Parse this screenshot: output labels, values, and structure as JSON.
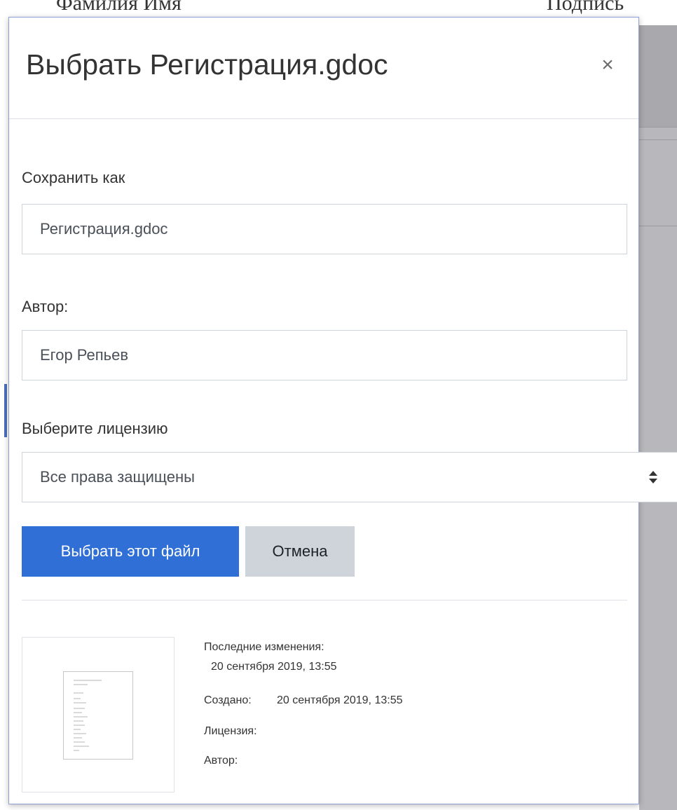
{
  "background": {
    "header_left": "Фамилия Имя",
    "header_right": "Подпись"
  },
  "dialog": {
    "title": "Выбрать Регистрация.gdoc",
    "close_label": "×"
  },
  "form": {
    "save_as_label": "Сохранить как",
    "save_as_value": "Регистрация.gdoc",
    "author_label": "Автор:",
    "author_value": "Егор Репьев",
    "license_label": "Выберите лицензию",
    "license_value": "Все права защищены"
  },
  "actions": {
    "select_label": "Выбрать этот файл",
    "cancel_label": "Отмена"
  },
  "details": {
    "modified_label": "Последние изменения:",
    "modified_value": "20 сентября 2019, 13:55",
    "created_label": "Создано:",
    "created_value": "20 сентября 2019, 13:55",
    "license_label": "Лицензия:",
    "author_label": "Автор:"
  },
  "colors": {
    "primary_button": "#2f6fd6",
    "secondary_button": "#ced4da",
    "dialog_border": "#8e9fd6"
  },
  "icons": {
    "close": "close-icon",
    "select_arrows": "sort-arrows-icon",
    "thumbnail": "document-thumbnail-icon"
  }
}
